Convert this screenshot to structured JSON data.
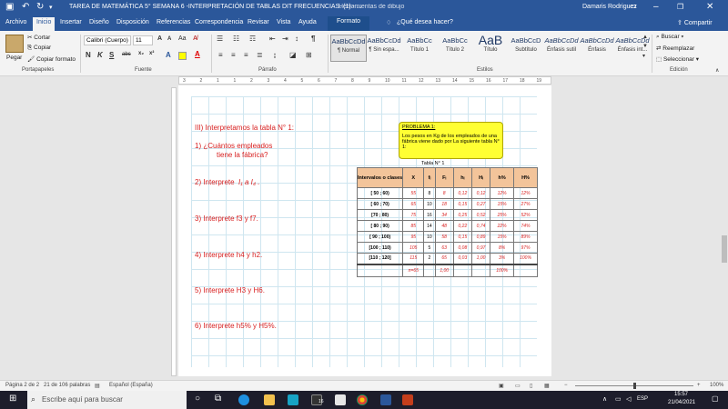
{
  "titlebar": {
    "doc_title": "TAREA DE MATEMÁTICA 5° SEMANA 6 -INTERPRETACIÓN DE TABLAS DIT FRECUENCIAS. (1) - ...",
    "context_tool": "Herramientas de dibujo",
    "user": "Damaris Rodriguez"
  },
  "tabs": {
    "archivo": "Archivo",
    "inicio": "Inicio",
    "insertar": "Insertar",
    "diseno": "Diseño",
    "disposicion": "Disposición",
    "referencias": "Referencias",
    "correspondencia": "Correspondencia",
    "revisar": "Revisar",
    "vista": "Vista",
    "ayuda": "Ayuda",
    "formato": "Formato",
    "tell_me": "¿Qué desea hacer?",
    "share": "Compartir"
  },
  "clipboard": {
    "paste": "Pegar",
    "cut": "Cortar",
    "copy": "Copiar",
    "format_painter": "Copiar formato",
    "group": "Portapapeles"
  },
  "font": {
    "name": "Calibri (Cuerpo)",
    "size": "11",
    "group": "Fuente",
    "bold": "N",
    "italic": "K",
    "underline": "S",
    "strike": "abc",
    "grow": "A",
    "shrink": "A",
    "case": "Aa"
  },
  "paragraph": {
    "group": "Párrafo",
    "pilcrow": "¶"
  },
  "styles": {
    "group": "Estilos",
    "items": [
      {
        "preview": "AaBbCcDd",
        "name": "¶ Normal"
      },
      {
        "preview": "AaBbCcDd",
        "name": "¶ Sin espa..."
      },
      {
        "preview": "AaBbCc",
        "name": "Título 1"
      },
      {
        "preview": "AaBbCc",
        "name": "Título 2"
      },
      {
        "preview": "AaB",
        "name": "Título"
      },
      {
        "preview": "AaBbCcD",
        "name": "Subtítulo"
      },
      {
        "preview": "AaBbCcDd",
        "name": "Énfasis sutil"
      },
      {
        "preview": "AaBbCcDd",
        "name": "Énfasis"
      },
      {
        "preview": "AaBbCcDd",
        "name": "Énfasis int..."
      }
    ]
  },
  "editing": {
    "group": "Edición",
    "find": "Buscar",
    "replace": "Reemplazar",
    "select": "Seleccionar"
  },
  "ruler": {
    "ticks": [
      "3",
      "2",
      "1",
      "1",
      "2",
      "3",
      "4",
      "5",
      "6",
      "7",
      "8",
      "9",
      "10",
      "11",
      "12",
      "13",
      "14",
      "15",
      "16",
      "17",
      "18",
      "19"
    ]
  },
  "doc": {
    "q1": "III) Interpretamos la tabla N° 1:",
    "q2a": "1) ¿Cuántos empleados",
    "q2b": "tiene la fábrica?",
    "q3": "2) Interprete",
    "q3hw": "I₁ a I₄ .",
    "q4": "3) Interprete f3 y f7.",
    "q5": "4) Interprete h4 y h2.",
    "q6": "5) Interprete H3 y H6.",
    "q7": "6) Interprete h5% y H5%.",
    "note_title": "PROBLEMA 1:",
    "note_body": "Los pesos en Kg de los empleados de una fábrica viene dado por La siguiente tabla N° 1:",
    "table_caption": "Tabla N° 1",
    "table": {
      "headers": [
        "Intervalos o clases",
        "X",
        "fᵢ",
        "Fᵢ",
        "hᵢ",
        "Hᵢ",
        "h%",
        "H%"
      ],
      "rows": [
        [
          "[ 50 ; 60)",
          "55",
          "8",
          "8",
          "0,12",
          "0,12",
          "12%",
          "12%"
        ],
        [
          "[ 60 ; 70)",
          "65",
          "10",
          "18",
          "0,15",
          "0,27",
          "15%",
          "27%"
        ],
        [
          "[70 ; 80)",
          "75",
          "16",
          "34",
          "0,25",
          "0,52",
          "25%",
          "52%"
        ],
        [
          "[ 80 ; 90)",
          "85",
          "14",
          "48",
          "0,22",
          "0,74",
          "22%",
          "74%"
        ],
        [
          "[ 90 ; 100)",
          "95",
          "10",
          "58",
          "0,15",
          "0,89",
          "15%",
          "89%"
        ],
        [
          "[100 ; 110)",
          "105",
          "5",
          "63",
          "0,08",
          "0,97",
          "8%",
          "97%"
        ],
        [
          "[110 ; 120]",
          "115",
          "2",
          "65",
          "0,03",
          "1,00",
          "3%",
          "100%"
        ]
      ],
      "total_row": [
        "",
        "n=65",
        "",
        "1,00",
        "",
        "",
        "100%",
        ""
      ],
      "row_marks": [
        "I₁",
        "I₂",
        "",
        "",
        "",
        "",
        "",
        "I₇"
      ]
    }
  },
  "status": {
    "page": "Página 2 de 2",
    "words": "21 de 106 palabras",
    "lang": "Español (España)",
    "zoom": "100%"
  },
  "taskbar": {
    "search": "Escribe aquí para buscar",
    "lang": "ESP",
    "time": "15:57",
    "date": "21/04/2021",
    "badge": "16"
  }
}
